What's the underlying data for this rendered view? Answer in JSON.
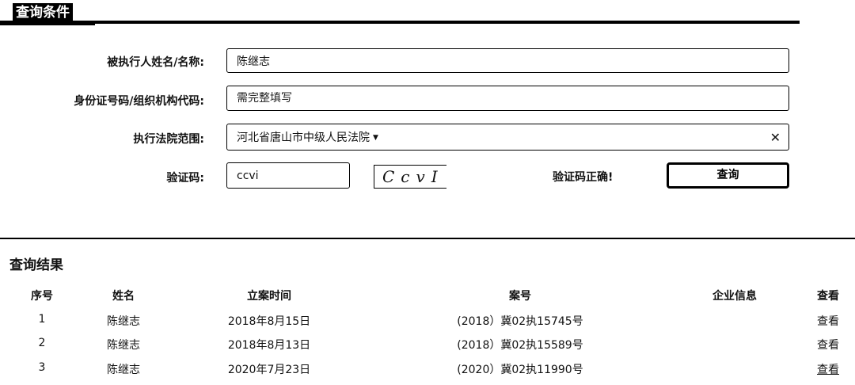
{
  "header": {
    "title": "查询条件"
  },
  "form": {
    "name_label": "被执行人姓名/名称:",
    "name_value": "陈继志",
    "id_label": "身份证号码/组织机构代码:",
    "id_placeholder": "需完整填写",
    "court_label": "执行法院范围:",
    "court_value": "河北省唐山市中级人民法院",
    "captcha_label": "验证码:",
    "captcha_value": "ccvi",
    "captcha_image_text": "CcvI",
    "captcha_status": "验证码正确!",
    "query_button": "查询",
    "clear_symbol": "✕",
    "caret_symbol": "▼"
  },
  "results": {
    "title": "查询结果",
    "columns": [
      "序号",
      "姓名",
      "立案时间",
      "案号",
      "企业信息",
      "查看"
    ],
    "rows": [
      {
        "index": "1",
        "name": "陈继志",
        "date": "2018年8月15日",
        "case_no": "(2018）冀02执15745号",
        "company": "",
        "view": "查看"
      },
      {
        "index": "2",
        "name": "陈继志",
        "date": "2018年8月13日",
        "case_no": "(2018）冀02执15589号",
        "company": "",
        "view": "查看"
      },
      {
        "index": "3",
        "name": "陈继志",
        "date": "2020年7月23日",
        "case_no": "(2020）冀02执11990号",
        "company": "",
        "view": "查看"
      }
    ]
  }
}
